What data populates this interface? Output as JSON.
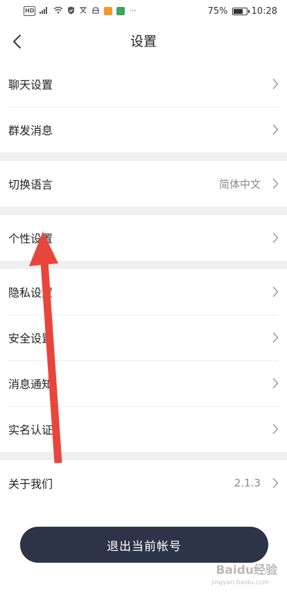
{
  "status_bar": {
    "hd_label": "HD",
    "signal_text": "⁴ᴳ",
    "ellipsis": "···",
    "battery_percent": "75%",
    "battery_level": 0.75,
    "time": "10:28"
  },
  "header": {
    "title": "设置",
    "back_icon": "chevron-left-icon"
  },
  "groups": [
    [
      {
        "label": "聊天设置",
        "value": ""
      },
      {
        "label": "群发消息",
        "value": ""
      }
    ],
    [
      {
        "label": "切换语言",
        "value": "简体中文"
      }
    ],
    [
      {
        "label": "个性设置",
        "value": ""
      }
    ],
    [
      {
        "label": "隐私设置",
        "value": ""
      },
      {
        "label": "安全设置",
        "value": ""
      },
      {
        "label": "消息通知",
        "value": ""
      },
      {
        "label": "实名认证",
        "value": ""
      }
    ],
    [
      {
        "label": "关于我们",
        "value": "2.1.3"
      }
    ]
  ],
  "logout_label": "退出当前帐号",
  "annotation": {
    "color": "#e8453c"
  },
  "watermark": {
    "brand": "Baidu经验",
    "url": "jingyan.baidu.com"
  },
  "colors": {
    "accent_dark": "#2d3447",
    "divider_gap": "#efefef",
    "arrow_red": "#e8453c"
  }
}
